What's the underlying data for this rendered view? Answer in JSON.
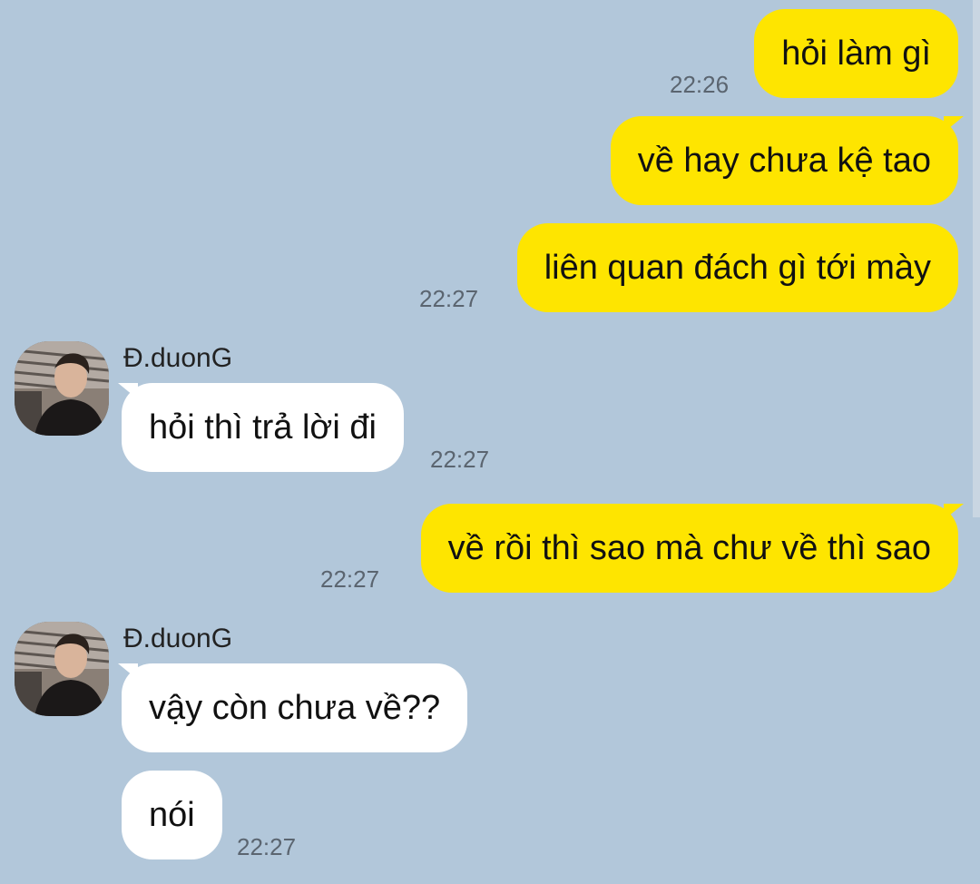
{
  "contact": {
    "name": "Đ.duonG",
    "avatar_icon": "person-photo-avatar"
  },
  "colors": {
    "background": "#b2c7da",
    "my_bubble": "#fee500",
    "their_bubble": "#ffffff",
    "timestamp": "#5b6570"
  },
  "messages": [
    {
      "sender": "me",
      "text": "hỏi làm gì",
      "time": "22:26"
    },
    {
      "sender": "me",
      "text": "về hay chưa kệ tao",
      "time": ""
    },
    {
      "sender": "me",
      "text": "liên quan đách gì tới mày",
      "time": "22:27"
    },
    {
      "sender": "them",
      "text": "hỏi thì trả lời đi",
      "time": "22:27"
    },
    {
      "sender": "me",
      "text": "về rồi thì sao mà chư về thì sao",
      "time": "22:27"
    },
    {
      "sender": "them",
      "text": "vậy còn chưa về??",
      "time": ""
    },
    {
      "sender": "them",
      "text": "nói",
      "time": "22:27"
    }
  ]
}
